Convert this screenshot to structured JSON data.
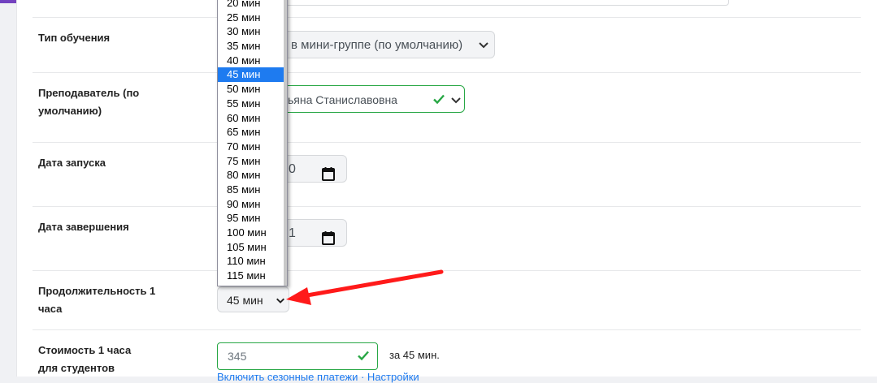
{
  "colors": {
    "accent": "#1e7bf0",
    "valid": "#28a745",
    "arrow": "#ff1a1a"
  },
  "rows": {
    "learning_type": {
      "label": "Тип обучения",
      "value": "в мини-группе (по умолчанию)"
    },
    "teacher": {
      "label": "Преподаватель (по умолчанию)",
      "value": "ьяна Станиславовна"
    },
    "start_date": {
      "label": "Дата запуска",
      "value_fragment": "0"
    },
    "end_date": {
      "label": "Дата завершения",
      "value_fragment": "1"
    },
    "duration": {
      "label": "Продолжительность 1 часа",
      "selected": "45 мин"
    },
    "price": {
      "label": "Стоимость 1 часа для студентов",
      "value": "345",
      "suffix": "за 45 мин.",
      "links": "Включить сезонные платежи · Настройки"
    }
  },
  "duration_dropdown": {
    "selected": "45 мин",
    "options": [
      "20 мин",
      "25 мин",
      "30 мин",
      "35 мин",
      "40 мин",
      "45 мин",
      "50 мин",
      "55 мин",
      "60 мин",
      "65 мин",
      "70 мин",
      "75 мин",
      "80 мин",
      "85 мин",
      "90 мин",
      "95 мин",
      "100 мин",
      "105 мин",
      "110 мин",
      "115 мин"
    ]
  },
  "icons": {
    "chevron": "chevron-down-icon",
    "check": "check-icon",
    "calendar": "calendar-icon",
    "arrow": "red-arrow-annotation"
  }
}
